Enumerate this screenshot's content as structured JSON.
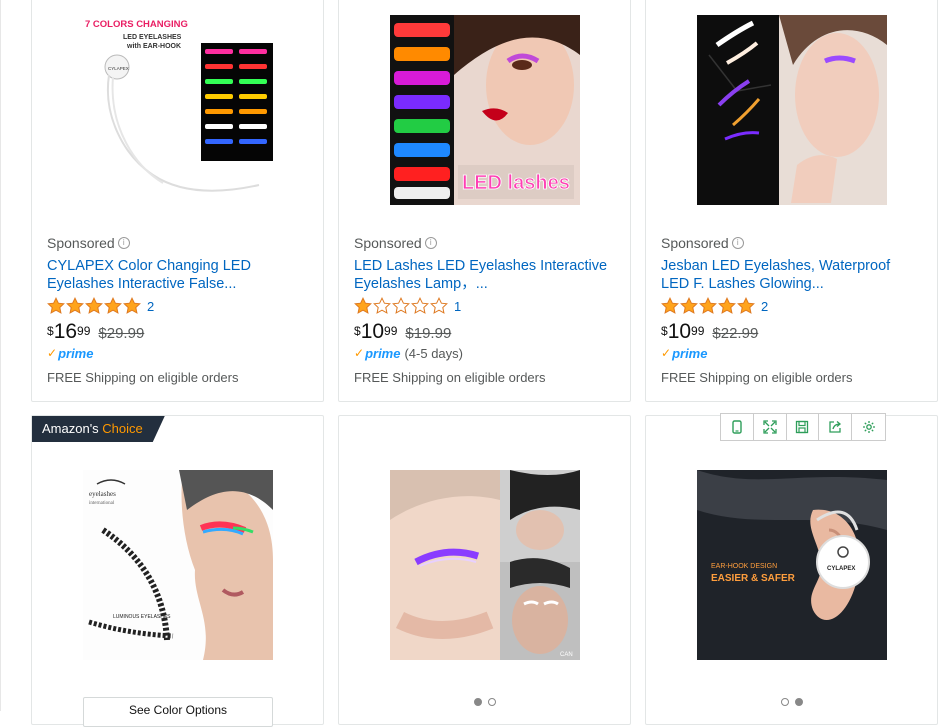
{
  "products": [
    {
      "sponsored": "Sponsored",
      "title_line1": "CYLAPEX Color Changing LED",
      "title_line2": "Eyelashes Interactive False...",
      "rating": 5,
      "rating_count": "2",
      "price_symbol": "$",
      "price_whole": "16",
      "price_fraction": "99",
      "list_price": "$29.99",
      "prime": "prime",
      "delivery": "",
      "shipping": "FREE Shipping on eligible orders",
      "image_text_1": "7 COLORS CHANGING",
      "image_text_2": "LED EYELASHES",
      "image_text_3": "with EAR-HOOK",
      "image_text_4": "CYLAPEX"
    },
    {
      "sponsored": "Sponsored",
      "title_line1": "LED Lashes LED Eyelashes Interactive",
      "title_line2": "Eyelashes Lamp，...",
      "rating": 1,
      "rating_count": "1",
      "price_symbol": "$",
      "price_whole": "10",
      "price_fraction": "99",
      "list_price": "$19.99",
      "prime": "prime",
      "delivery": "(4-5 days)",
      "shipping": "FREE Shipping on eligible orders",
      "image_text_1": "LED lashes"
    },
    {
      "sponsored": "Sponsored",
      "title_line1": "Jesban LED Eyelashes, Waterproof",
      "title_line2": "LED F. Lashes Glowing...",
      "rating": 5,
      "rating_count": "2",
      "price_symbol": "$",
      "price_whole": "10",
      "price_fraction": "99",
      "list_price": "$22.99",
      "prime": "prime",
      "delivery": "",
      "shipping": "FREE Shipping on eligible orders"
    }
  ],
  "bottom_row": {
    "badge_prefix": "Amazon's",
    "badge_choice": "Choice",
    "see_options": "See Color Options",
    "img1_brand_1": "eyelashes",
    "img1_brand_2": "international",
    "img1_caption": "LUMINOUS EYELASHES",
    "img2_tag": "CAN",
    "img3_text_1": "EAR-HOOK DESIGN",
    "img3_text_2": "EASIER & SAFER",
    "img3_brand": "CYLAPEX"
  },
  "carousels": [
    {
      "total": 2,
      "active": 0
    },
    {
      "total": 2,
      "active": 1
    }
  ],
  "toolbar": {
    "icons": [
      "mobile-icon",
      "expand-icon",
      "save-icon",
      "share-icon",
      "settings-icon"
    ]
  },
  "colors": {
    "link": "#0066c0",
    "star": "#ffa41c",
    "prime": "#1a98ff",
    "badge_bg": "#232f3e",
    "badge_accent": "#ff9900",
    "toolbar_icon": "#2e9e5a"
  }
}
